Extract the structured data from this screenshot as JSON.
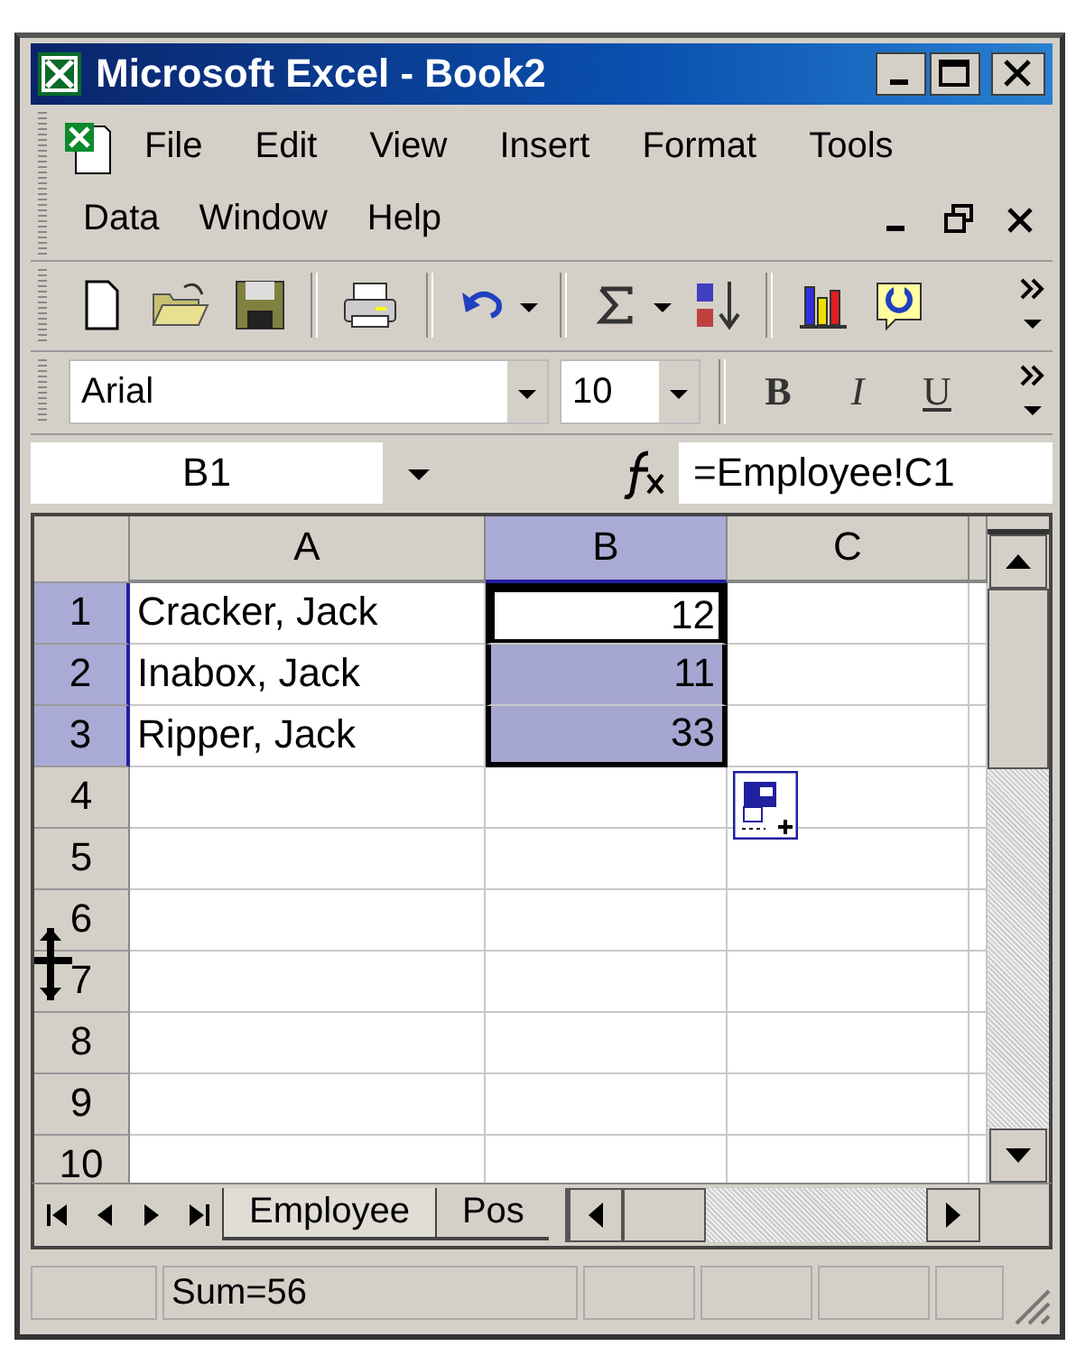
{
  "window": {
    "title": "Microsoft Excel - Book2"
  },
  "menu": [
    {
      "label": "File"
    },
    {
      "label": "Edit"
    },
    {
      "label": "View"
    },
    {
      "label": "Insert"
    },
    {
      "label": "Format"
    },
    {
      "label": "Tools"
    },
    {
      "label": "Data"
    },
    {
      "label": "Window"
    },
    {
      "label": "Help"
    }
  ],
  "formatting": {
    "font": "Arial",
    "size": "10",
    "bold": "B",
    "italic": "I",
    "underline": "U"
  },
  "formula_bar": {
    "name_box": "B1",
    "formula": "=Employee!C1"
  },
  "columns": [
    {
      "label": "A",
      "selected": false
    },
    {
      "label": "B",
      "selected": true
    },
    {
      "label": "C",
      "selected": false
    }
  ],
  "rows": [
    {
      "header": "1",
      "selected": true,
      "cells": [
        {
          "text": "Cracker, Jack",
          "selected": false,
          "active": false
        },
        {
          "text": "12",
          "selected": true,
          "active": true
        }
      ]
    },
    {
      "header": "2",
      "selected": true,
      "cells": [
        {
          "text": "Inabox, Jack",
          "selected": false,
          "active": false
        },
        {
          "text": "11",
          "selected": true,
          "active": false
        }
      ]
    },
    {
      "header": "3",
      "selected": true,
      "cells": [
        {
          "text": "Ripper, Jack",
          "selected": false,
          "active": false
        },
        {
          "text": "33",
          "selected": true,
          "active": false
        }
      ]
    },
    {
      "header": "4",
      "selected": false
    },
    {
      "header": "5",
      "selected": false
    },
    {
      "header": "6",
      "selected": false
    },
    {
      "header": "7",
      "selected": false
    },
    {
      "header": "8",
      "selected": false
    },
    {
      "header": "9",
      "selected": false
    },
    {
      "header": "10",
      "selected": false
    }
  ],
  "sheet_tabs": [
    {
      "label": "Employee",
      "selected": true
    },
    {
      "label": "Pos",
      "selected": false
    }
  ],
  "status_bar": {
    "text": "Sum=56"
  }
}
